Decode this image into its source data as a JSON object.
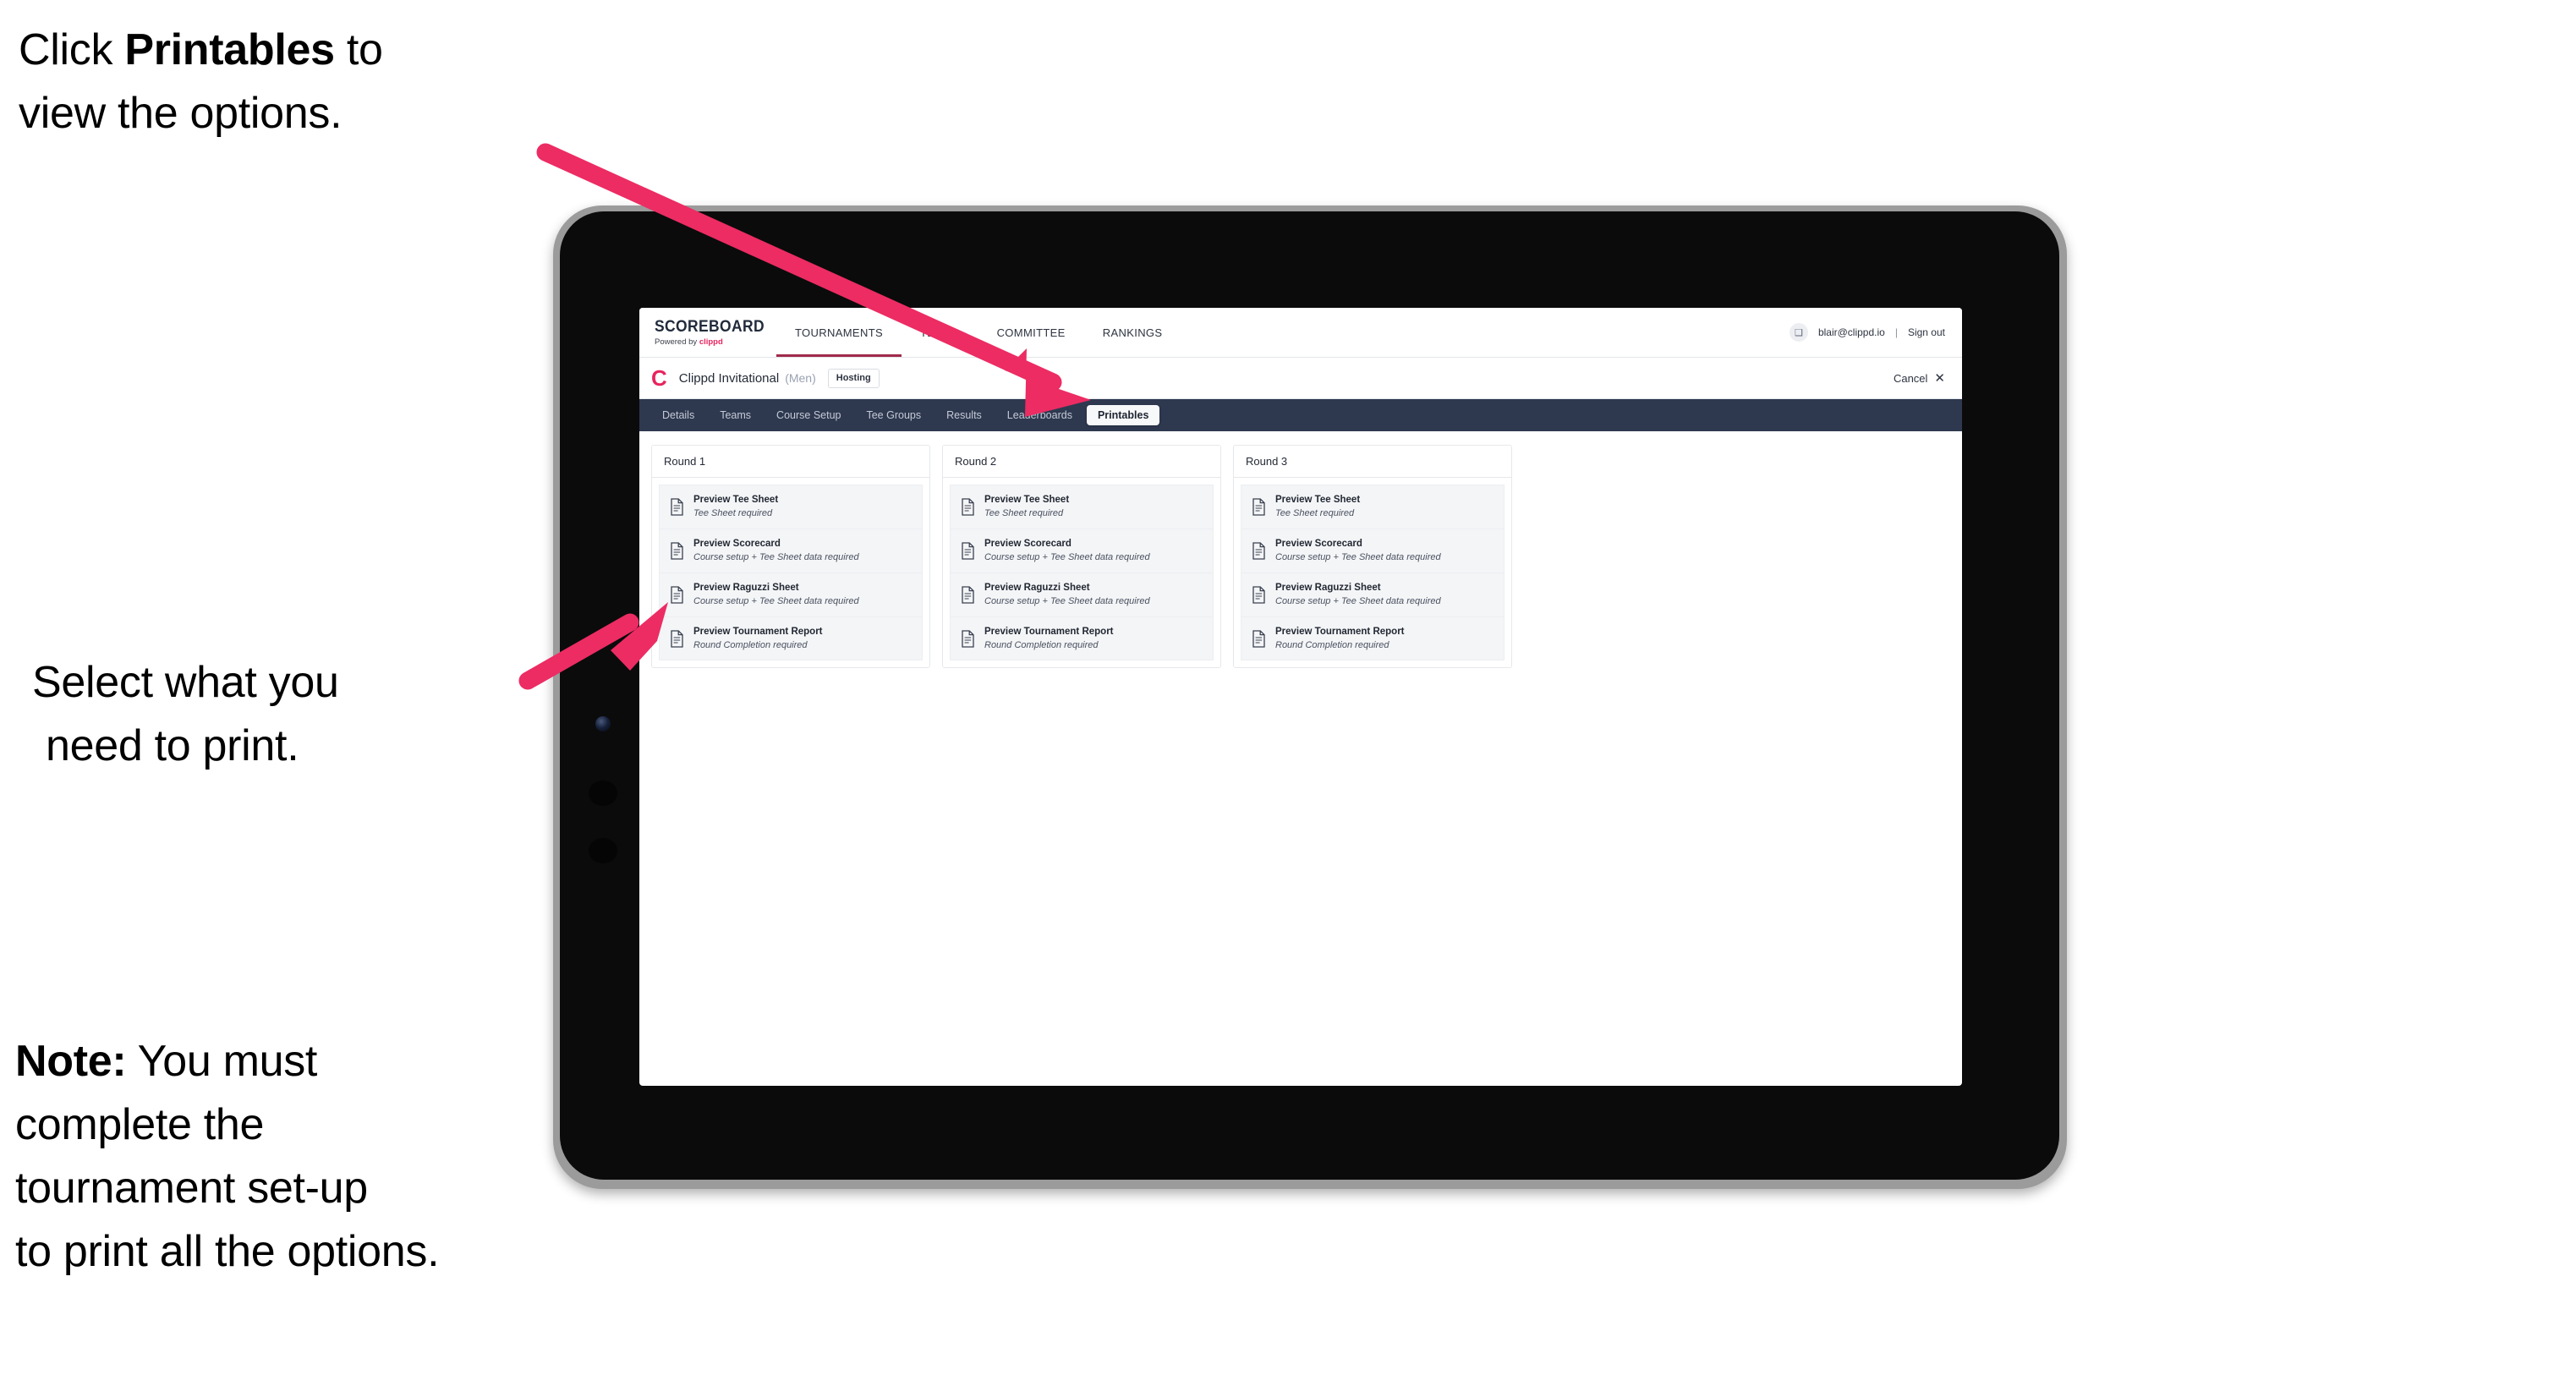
{
  "annotations": {
    "a1_pre": "Click ",
    "a1_bold": "Printables",
    "a1_post": " to",
    "a1_line2": "view the options.",
    "a2_line1": "Select what you",
    "a2_line2": "need to print.",
    "a3_bold": "Note:",
    "a3_rest": " You must",
    "a3_line2": "complete the",
    "a3_line3": "tournament set-up",
    "a3_line4": "to print all the options."
  },
  "colors": {
    "accent_pink": "#e8245f",
    "arrow_pink": "#ec2c63",
    "tabbar_navy": "#2e3950",
    "nav_active_underline": "#a02b4a"
  },
  "app": {
    "brand": {
      "title": "SCOREBOARD",
      "sub_prefix": "Powered by ",
      "sub_brand": "clippd"
    },
    "topnav": [
      {
        "label": "TOURNAMENTS",
        "active": true
      },
      {
        "label": "TEAMS",
        "active": false
      },
      {
        "label": "COMMITTEE",
        "active": false
      },
      {
        "label": "RANKINGS",
        "active": false
      }
    ],
    "account": {
      "avatar_glyph": "❑",
      "email": "blair@clippd.io",
      "separator": "|",
      "sign_out": "Sign out"
    },
    "tournament": {
      "logo_letter": "C",
      "name": "Clippd Invitational",
      "gender": "(Men)",
      "status_badge": "Hosting",
      "cancel_label": "Cancel",
      "cancel_icon": "✕"
    },
    "tabs": [
      {
        "label": "Details",
        "active": false
      },
      {
        "label": "Teams",
        "active": false
      },
      {
        "label": "Course Setup",
        "active": false
      },
      {
        "label": "Tee Groups",
        "active": false
      },
      {
        "label": "Results",
        "active": false
      },
      {
        "label": "Leaderboards",
        "active": false
      },
      {
        "label": "Printables",
        "active": true
      }
    ],
    "rounds": [
      {
        "header": "Round 1",
        "items": [
          {
            "title": "Preview Tee Sheet",
            "sub": "Tee Sheet required"
          },
          {
            "title": "Preview Scorecard",
            "sub": "Course setup + Tee Sheet data required"
          },
          {
            "title": "Preview Raguzzi Sheet",
            "sub": "Course setup + Tee Sheet data required"
          },
          {
            "title": "Preview Tournament Report",
            "sub": "Round Completion required"
          }
        ]
      },
      {
        "header": "Round 2",
        "items": [
          {
            "title": "Preview Tee Sheet",
            "sub": "Tee Sheet required"
          },
          {
            "title": "Preview Scorecard",
            "sub": "Course setup + Tee Sheet data required"
          },
          {
            "title": "Preview Raguzzi Sheet",
            "sub": "Course setup + Tee Sheet data required"
          },
          {
            "title": "Preview Tournament Report",
            "sub": "Round Completion required"
          }
        ]
      },
      {
        "header": "Round 3",
        "items": [
          {
            "title": "Preview Tee Sheet",
            "sub": "Tee Sheet required"
          },
          {
            "title": "Preview Scorecard",
            "sub": "Course setup + Tee Sheet data required"
          },
          {
            "title": "Preview Raguzzi Sheet",
            "sub": "Course setup + Tee Sheet data required"
          },
          {
            "title": "Preview Tournament Report",
            "sub": "Round Completion required"
          }
        ]
      }
    ]
  }
}
